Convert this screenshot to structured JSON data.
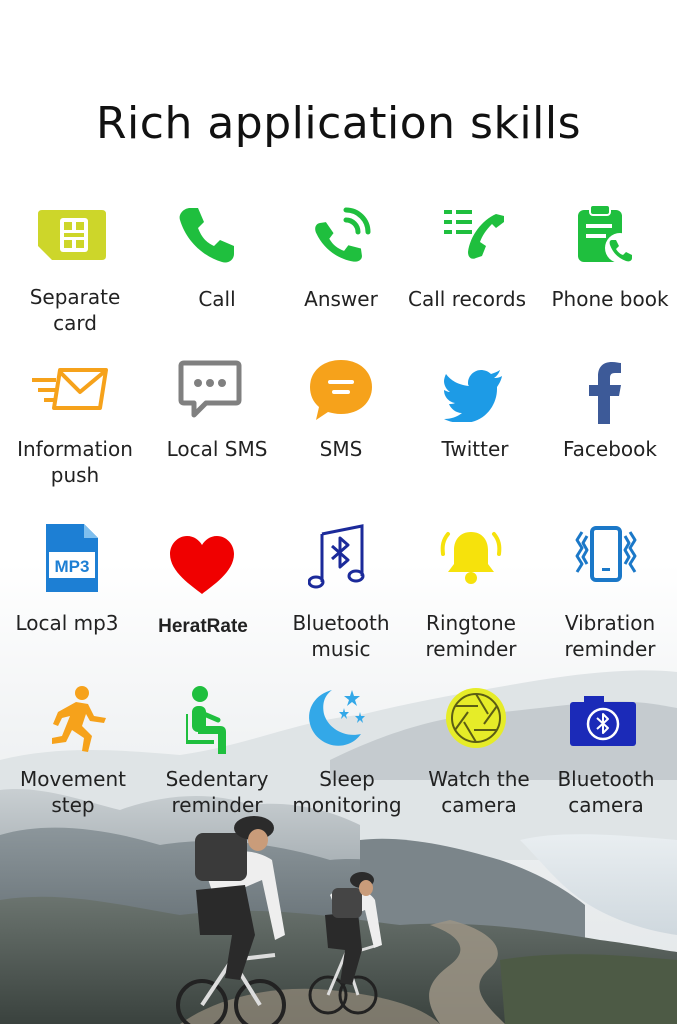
{
  "title": "Rich application skills",
  "colors": {
    "green": "#1fbf3e",
    "orange": "#f6a21b",
    "blue": "#1d7fd4",
    "grey": "#808080",
    "red": "#f00000",
    "yellow": "#f6e20c",
    "sim_yellow": "#cdd62a",
    "dark_blue": "#1b2a9a"
  },
  "features": [
    {
      "label": "Separate\ncard",
      "icon": "sim-card-icon"
    },
    {
      "label": "Call",
      "icon": "phone-icon"
    },
    {
      "label": "Answer",
      "icon": "phone-ringing-icon"
    },
    {
      "label": "Call records",
      "icon": "call-log-icon"
    },
    {
      "label": "Phone book",
      "icon": "clipboard-phone-icon"
    },
    {
      "label": "Information\npush",
      "icon": "envelope-fast-icon"
    },
    {
      "label": "Local SMS",
      "icon": "chat-bubble-icon"
    },
    {
      "label": "SMS",
      "icon": "message-bubble-icon"
    },
    {
      "label": "Twitter",
      "icon": "twitter-bird-icon"
    },
    {
      "label": "Facebook",
      "icon": "facebook-f-icon"
    },
    {
      "label": "Local mp3",
      "icon": "mp3-file-icon",
      "icon_text": "MP3"
    },
    {
      "label": "HeratRate",
      "icon": "heart-icon"
    },
    {
      "label": "Bluetooth\nmusic",
      "icon": "bluetooth-music-icon"
    },
    {
      "label": "Ringtone\nreminder",
      "icon": "bell-icon"
    },
    {
      "label": "Vibration\nreminder",
      "icon": "vibrating-phone-icon"
    },
    {
      "label": "Movement\nstep",
      "icon": "running-man-icon"
    },
    {
      "label": "Sedentary\nreminder",
      "icon": "sitting-person-icon"
    },
    {
      "label": "Sleep\nmonitoring",
      "icon": "moon-stars-icon"
    },
    {
      "label": "Watch the\ncamera",
      "icon": "aperture-icon"
    },
    {
      "label": "Bluetooth\ncamera",
      "icon": "bluetooth-camera-icon"
    }
  ]
}
